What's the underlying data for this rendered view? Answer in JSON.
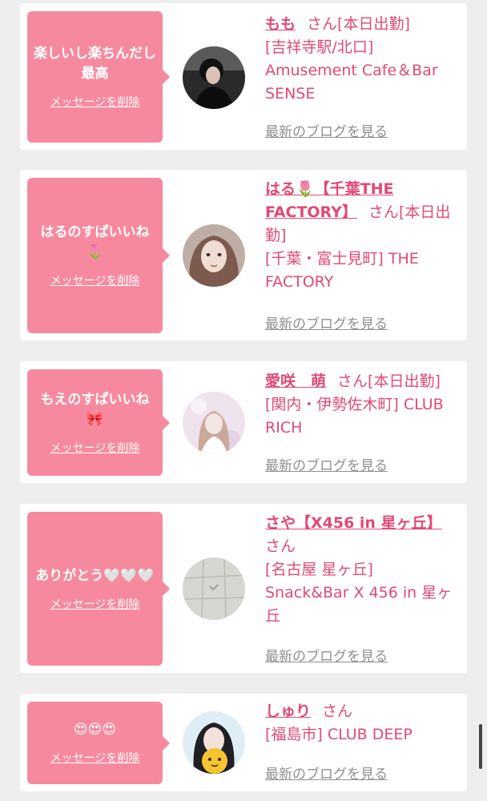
{
  "messages": [
    {
      "message": "楽しいし楽ちんだし最高",
      "delete_label": "メッセージを削除",
      "name": "もも",
      "honorific": "さん",
      "status": "[本日出勤]",
      "location": "[吉祥寺駅/北口] Amusement Cafe＆Bar SENSE",
      "blog_label": "最新のブログを見る"
    },
    {
      "message": "はるのすぱいいね🌷",
      "delete_label": "メッセージを削除",
      "name": "はる🌷【千葉THE FACTORY】",
      "honorific": "さん",
      "status": "[本日出勤]",
      "location": "[千葉・富士見町] THE FACTORY",
      "blog_label": "最新のブログを見る"
    },
    {
      "message": "もえのすぱいいね🎀",
      "delete_label": "メッセージを削除",
      "name": "愛咲　萌",
      "honorific": "さん",
      "status": "[本日出勤]",
      "location": "[関内・伊勢佐木町] CLUB RICH",
      "blog_label": "最新のブログを見る"
    },
    {
      "message": "ありがとう🤍🤍🤍",
      "delete_label": "メッセージを削除",
      "name": "さや【X456 in 星ヶ丘】",
      "honorific": "さん",
      "status": "",
      "location": "[名古屋 星ヶ丘] Snack&Bar X 456 in 星ヶ丘",
      "blog_label": "最新のブログを見る"
    },
    {
      "message": "😍😍😍",
      "delete_label": "メッセージを削除",
      "name": "しゅり",
      "honorific": "さん",
      "status": "",
      "location": "[福島市] CLUB DEEP",
      "blog_label": "最新のブログを見る"
    }
  ]
}
